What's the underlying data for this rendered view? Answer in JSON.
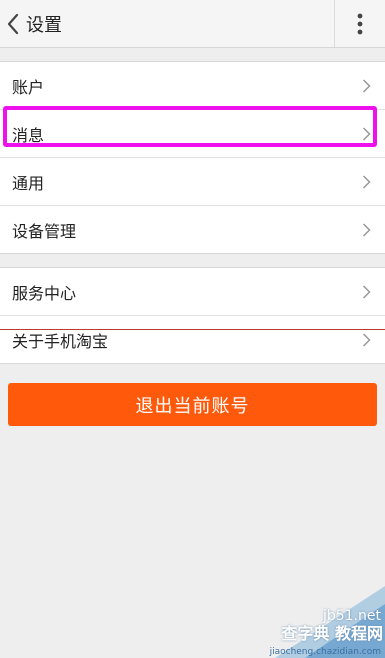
{
  "header": {
    "title": "设置"
  },
  "groups": [
    {
      "items": [
        "账户",
        "消息",
        "通用",
        "设备管理"
      ]
    },
    {
      "items": [
        "服务中心",
        "关于手机淘宝"
      ]
    }
  ],
  "logout_button": "退出当前账号",
  "watermark": {
    "line1": "jb51.net",
    "line2": "查字典 教程网",
    "line3": "jiaocheng.chazidian.com"
  },
  "colors": {
    "accent": "#ff5a0c",
    "highlight": "#ee11ee"
  }
}
